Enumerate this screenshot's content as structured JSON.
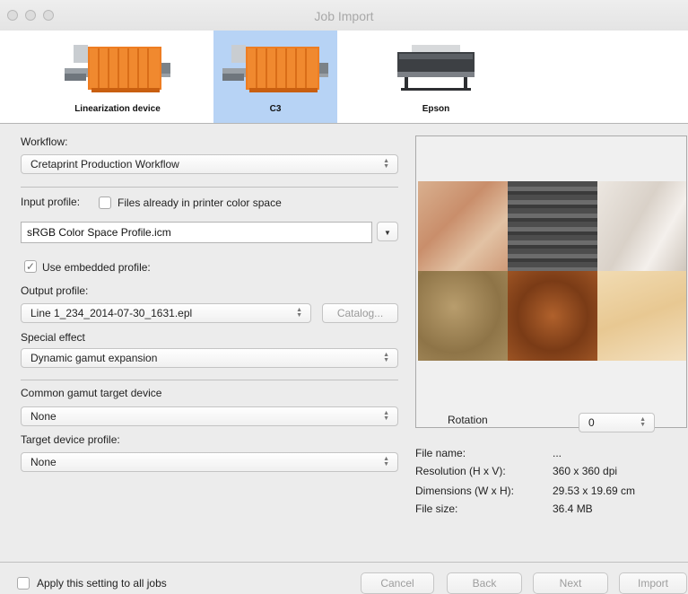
{
  "window": {
    "title": "Job Import"
  },
  "devices": [
    {
      "label": "Linearization device",
      "selected": false
    },
    {
      "label": "C3",
      "selected": true
    },
    {
      "label": "Epson",
      "selected": false
    }
  ],
  "workflow": {
    "label": "Workflow:",
    "value": "Cretaprint Production Workflow"
  },
  "input_profile": {
    "label": "Input profile:",
    "printer_space_checkbox": {
      "label": "Files already in printer color space",
      "checked": false
    },
    "value": "sRGB Color Space Profile.icm",
    "use_embedded": {
      "label": "Use embedded profile:",
      "checked": true,
      "check_glyph": "✓"
    }
  },
  "output_profile": {
    "label": "Output profile:",
    "value": "Line 1_234_2014-07-30_1631.epl",
    "catalog_label": "Catalog..."
  },
  "special_effect": {
    "label": "Special effect",
    "value": "Dynamic gamut expansion"
  },
  "common_gamut": {
    "label": "Common gamut target device",
    "value": "None"
  },
  "target_device_profile": {
    "label": "Target device profile:",
    "value": "None"
  },
  "rotation": {
    "label": "Rotation",
    "value": "0"
  },
  "file_info": [
    {
      "key": "File name:",
      "value": "..."
    },
    {
      "key": "Resolution (H x V):",
      "value": "360 x 360 dpi"
    },
    {
      "key": "Dimensions (W x H):",
      "value": "29.53 x 19.69 cm"
    },
    {
      "key": "File size:",
      "value": "36.4 MB"
    }
  ],
  "footer": {
    "apply_all": {
      "label": "Apply this setting to all jobs",
      "checked": false
    },
    "buttons": {
      "cancel": "Cancel",
      "back": "Back",
      "next": "Next",
      "import": "Import"
    }
  },
  "colors": {
    "selected_device_bg": "#b7d3f5",
    "printer_orange": "#ee7d22"
  }
}
